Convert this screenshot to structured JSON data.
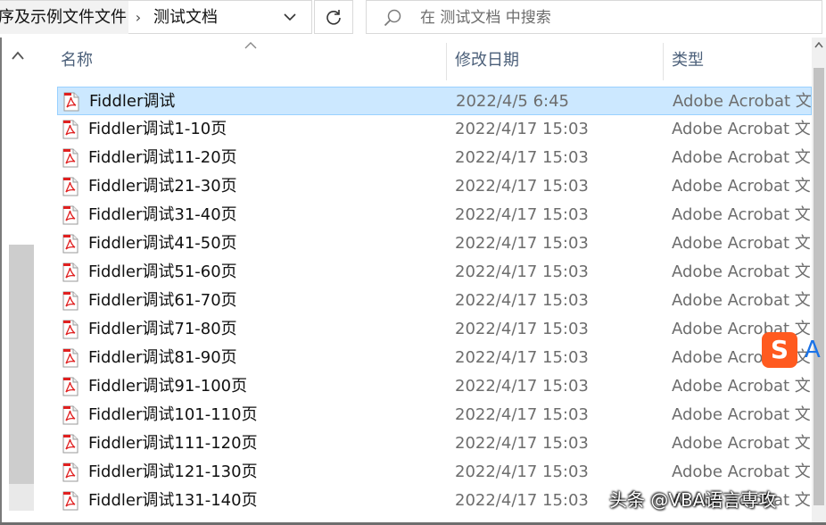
{
  "breadcrumb": {
    "parent_label": "序及示例文件文件",
    "separator": "›",
    "current_label": "测试文档"
  },
  "search": {
    "placeholder": "在 测试文档 中搜索"
  },
  "columns": {
    "name": "名称",
    "date_modified": "修改日期",
    "type": "类型"
  },
  "icons": {
    "dropdown": "chevron-down-icon",
    "refresh": "refresh-icon",
    "search": "search-icon",
    "pdf": "pdf-file-icon"
  },
  "colors": {
    "selection_bg": "#cce8ff",
    "selection_border": "#99d1ff",
    "header_text": "#4c607a",
    "pdf_red": "#e02020"
  },
  "files": [
    {
      "name": "Fiddler调试",
      "date": "2022/4/5 6:45",
      "type": "Adobe Acrobat 文",
      "selected": true
    },
    {
      "name": "Fiddler调试1-10页",
      "date": "2022/4/17 15:03",
      "type": "Adobe Acrobat 文",
      "selected": false
    },
    {
      "name": "Fiddler调试11-20页",
      "date": "2022/4/17 15:03",
      "type": "Adobe Acrobat 文",
      "selected": false
    },
    {
      "name": "Fiddler调试21-30页",
      "date": "2022/4/17 15:03",
      "type": "Adobe Acrobat 文",
      "selected": false
    },
    {
      "name": "Fiddler调试31-40页",
      "date": "2022/4/17 15:03",
      "type": "Adobe Acrobat 文",
      "selected": false
    },
    {
      "name": "Fiddler调试41-50页",
      "date": "2022/4/17 15:03",
      "type": "Adobe Acrobat 文",
      "selected": false
    },
    {
      "name": "Fiddler调试51-60页",
      "date": "2022/4/17 15:03",
      "type": "Adobe Acrobat 文",
      "selected": false
    },
    {
      "name": "Fiddler调试61-70页",
      "date": "2022/4/17 15:03",
      "type": "Adobe Acrobat 文",
      "selected": false
    },
    {
      "name": "Fiddler调试71-80页",
      "date": "2022/4/17 15:03",
      "type": "Adobe Acrobat 文",
      "selected": false
    },
    {
      "name": "Fiddler调试81-90页",
      "date": "2022/4/17 15:03",
      "type": "Adobe Acrobat 文",
      "selected": false
    },
    {
      "name": "Fiddler调试91-100页",
      "date": "2022/4/17 15:03",
      "type": "Adobe Acrobat 文",
      "selected": false
    },
    {
      "name": "Fiddler调试101-110页",
      "date": "2022/4/17 15:03",
      "type": "Adobe Acrobat 文",
      "selected": false
    },
    {
      "name": "Fiddler调试111-120页",
      "date": "2022/4/17 15:03",
      "type": "Adobe Acrobat 文",
      "selected": false
    },
    {
      "name": "Fiddler调试121-130页",
      "date": "2022/4/17 15:03",
      "type": "Adobe Acrobat 文",
      "selected": false
    },
    {
      "name": "Fiddler调试131-140页",
      "date": "2022/4/17 15:03",
      "type": "Adobe Acrobat 文",
      "selected": false
    }
  ],
  "ime_badge": {
    "logo_letter": "S",
    "text": "A"
  },
  "watermark": {
    "text": "头条 @VBA语言専攻"
  }
}
